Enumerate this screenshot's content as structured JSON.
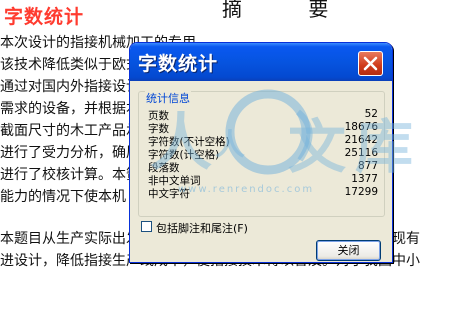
{
  "document": {
    "title": "字数统计",
    "heading": "摘  要",
    "lines": [
      "本次设计的指接机械加工的专用",
      "该技术降低类似于欧式市场竞争力",
      "通过对国内外指接设计，设计了能",
      "需求的设备，并根据本机床的工",
      "截面尺寸的木工产品承受一定的",
      "进行了受力分析，确属部分，如",
      "进行了校核计算。本簧力进行了",
      "能力的情况下使本机",
      "本题目从生产实际出发，为小径木材指榫加工设计关键设备，对现有",
      "进设计，降低指接生产线成本，使指接技术得以普及。对于我国中小"
    ]
  },
  "dialog": {
    "title": "字数统计",
    "group_label": "统计信息",
    "stats": [
      {
        "label": "页数",
        "value": "52"
      },
      {
        "label": "字数",
        "value": "18676"
      },
      {
        "label": "字符数(不计空格)",
        "value": "21642"
      },
      {
        "label": "字符数(计空格)",
        "value": "25116"
      },
      {
        "label": "段落数",
        "value": "877"
      },
      {
        "label": "非中文单词",
        "value": "1377"
      },
      {
        "label": "中文字符",
        "value": "17299"
      }
    ],
    "checkbox_label": "包括脚注和尾注(F)",
    "checkbox_checked": false,
    "close_label": "关闭"
  },
  "watermark": {
    "glyph_a": "人",
    "glyph_b": "文",
    "glyph_c": "库",
    "url": "www.renrendoc.com"
  }
}
